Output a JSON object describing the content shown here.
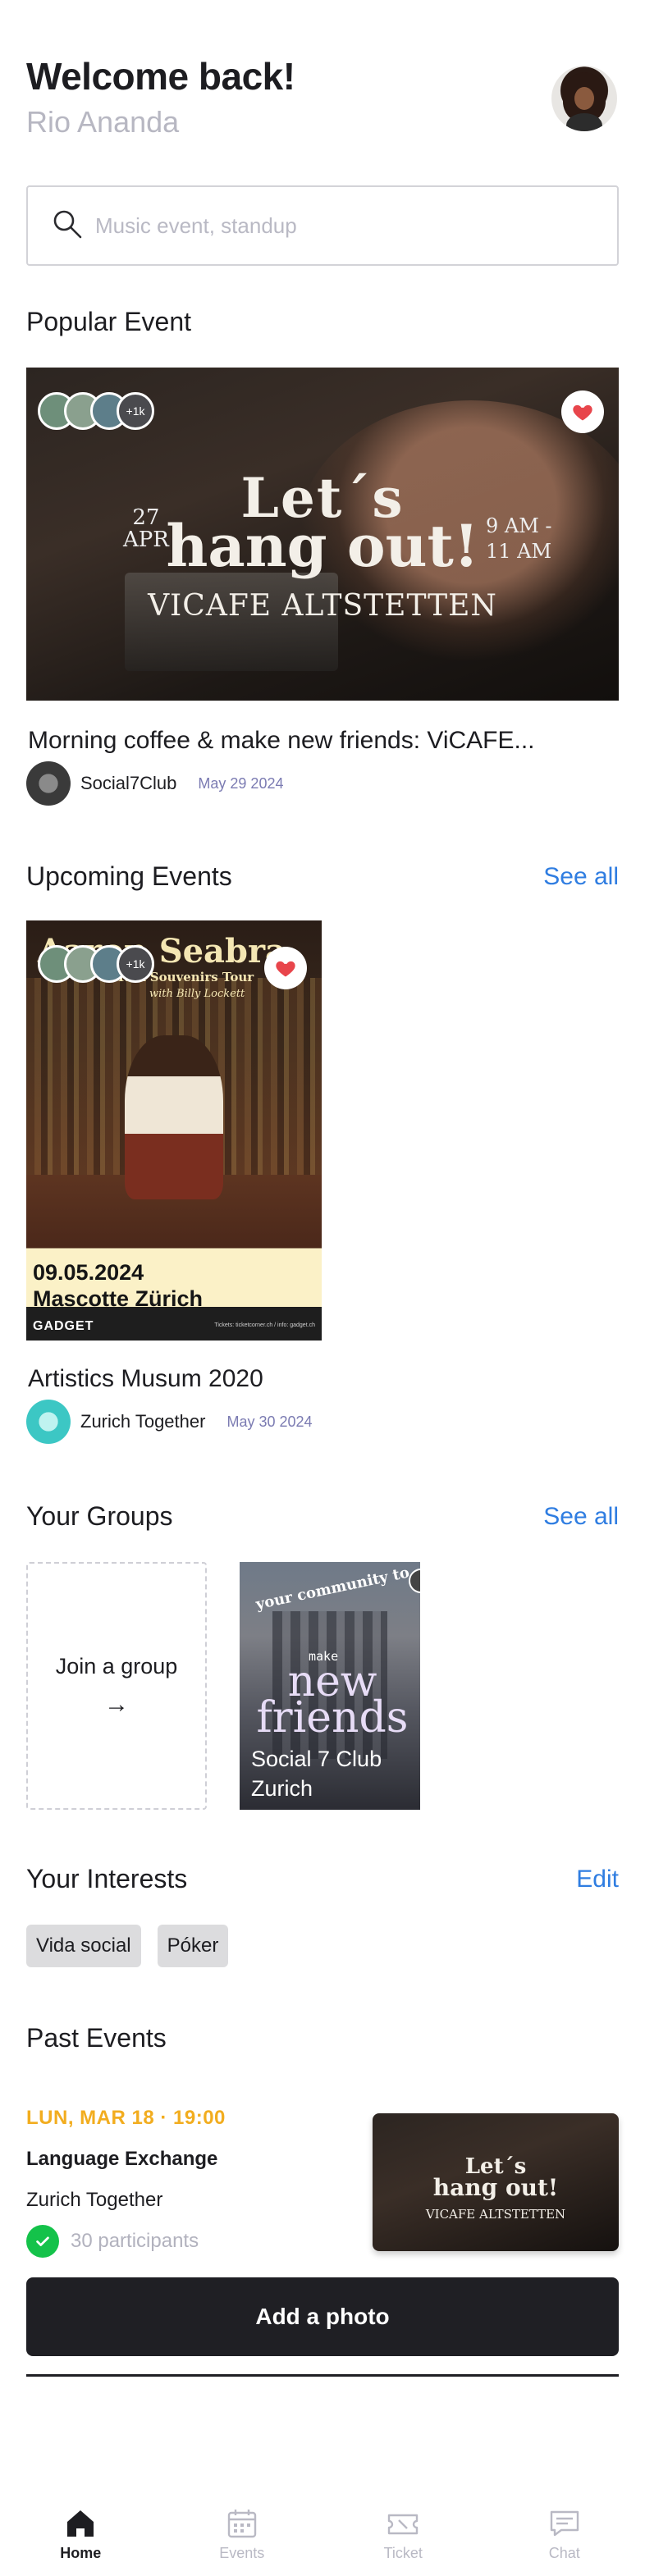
{
  "header": {
    "greeting": "Welcome back!",
    "username": "Rio Ananda"
  },
  "search": {
    "placeholder": "Music event, standup"
  },
  "popular": {
    "section_title": "Popular Event",
    "event": {
      "poster_line1": "Let´s",
      "poster_line2": "hang out!",
      "poster_venue": "VICAFE ALTSTETTEN",
      "poster_day": "27",
      "poster_month": "APR",
      "poster_time_start": "9 AM -",
      "poster_time_end": "11 AM",
      "attendee_more": "+1k",
      "title": "Morning coffee & make new friends: ViCAFE...",
      "host": "Social7Club",
      "date": "May 29 2024"
    }
  },
  "upcoming": {
    "section_title": "Upcoming Events",
    "see_all": "See all",
    "event": {
      "poster_name": "Aaron Seabra",
      "poster_sub1": "Talk Souvenirs Tour",
      "poster_sub2": "with Billy Lockett",
      "poster_date": "09.05.2024",
      "poster_venue": "Mascotte Zürich",
      "poster_brand": "GADGET",
      "poster_tickets": "Tickets: ticketcorner.ch / info: gadget.ch",
      "attendee_more": "+1k",
      "title": "Artistics Musum 2020",
      "host": "Zurich Together",
      "date": "May 30 2024"
    }
  },
  "groups": {
    "section_title": "Your Groups",
    "see_all": "See all",
    "join_label": "Join a group",
    "join_arrow": "→",
    "group": {
      "poster_curve": "your community to",
      "poster_make": "make",
      "poster_new": "new",
      "poster_friends": "friends",
      "name_line1": "Social 7 Club",
      "name_line2": "Zurich"
    }
  },
  "interests": {
    "section_title": "Your Interests",
    "edit": "Edit",
    "chips": [
      "Vida social",
      "Póker"
    ]
  },
  "past": {
    "section_title": "Past Events",
    "date": "LUN, MAR 18 · 19:00",
    "title": "Language Exchange",
    "host": "Zurich Together",
    "participants": "30 participants",
    "thumb_line1": "Let´s",
    "thumb_line2": "hang out!",
    "thumb_venue": "VICAFE ALTSTETTEN",
    "add_photo": "Add a photo"
  },
  "nav": {
    "items": [
      {
        "label": "Home",
        "icon": "home-icon",
        "active": true
      },
      {
        "label": "Events",
        "icon": "calendar-icon",
        "active": false
      },
      {
        "label": "Ticket",
        "icon": "ticket-icon",
        "active": false
      },
      {
        "label": "Chat",
        "icon": "chat-icon",
        "active": false
      }
    ]
  },
  "colors": {
    "accent_link": "#2f7de1",
    "past_date": "#f2ad1f",
    "check_green": "#14c24a",
    "heart_red": "#e8454b",
    "button_dark": "#1f1f24"
  }
}
